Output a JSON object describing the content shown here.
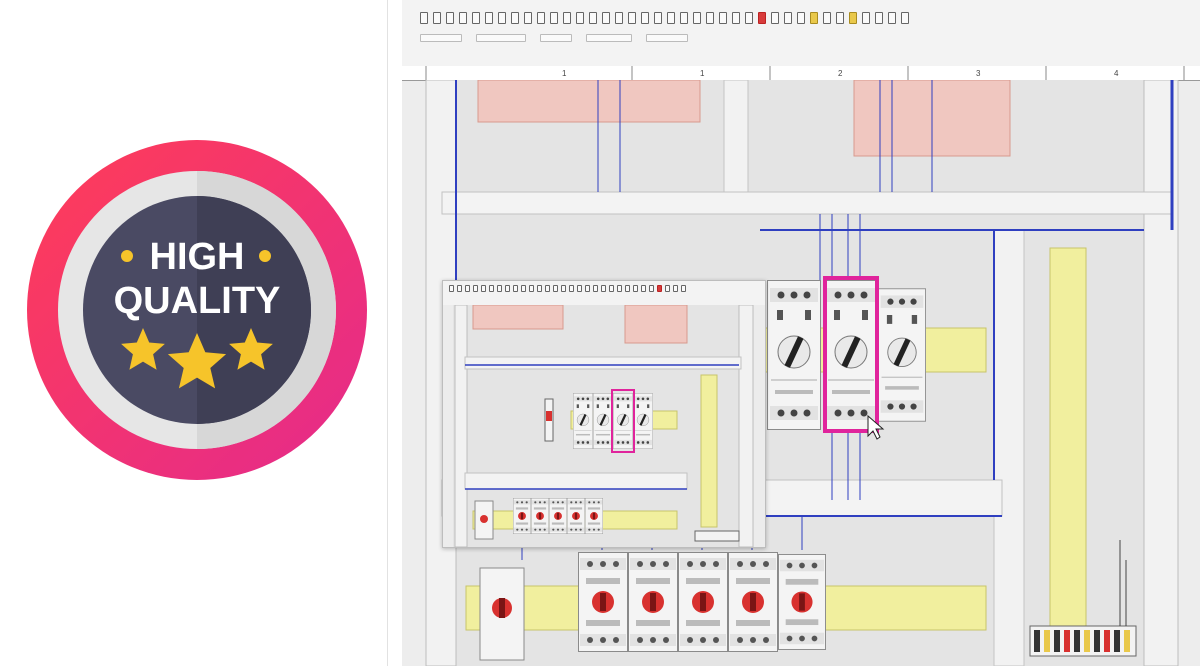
{
  "badge": {
    "line1": "HIGH",
    "line2": "QUALITY",
    "star_count": 3,
    "colors": {
      "ring_start": "#ff3d57",
      "ring_end": "#e42a8c",
      "inner_ring": "#e6e6e6",
      "disc": "#4a4a63",
      "text": "#ffffff",
      "star": "#f6c42a"
    }
  },
  "cad": {
    "colors": {
      "wire": "#2f3fc0",
      "rail": "#f1ef9e",
      "highlight": "#e0249c",
      "breaker_handle": "#d8312f",
      "duct_fill": "#f0c7c0",
      "duct_border": "#d89a8e"
    },
    "ruler_marks": [
      "1",
      "1",
      "2",
      "3",
      "4",
      "4"
    ],
    "toolbar_buttons": 38,
    "inset_toolbar_buttons": 30,
    "selected_module": "disconnect-switch-3"
  }
}
